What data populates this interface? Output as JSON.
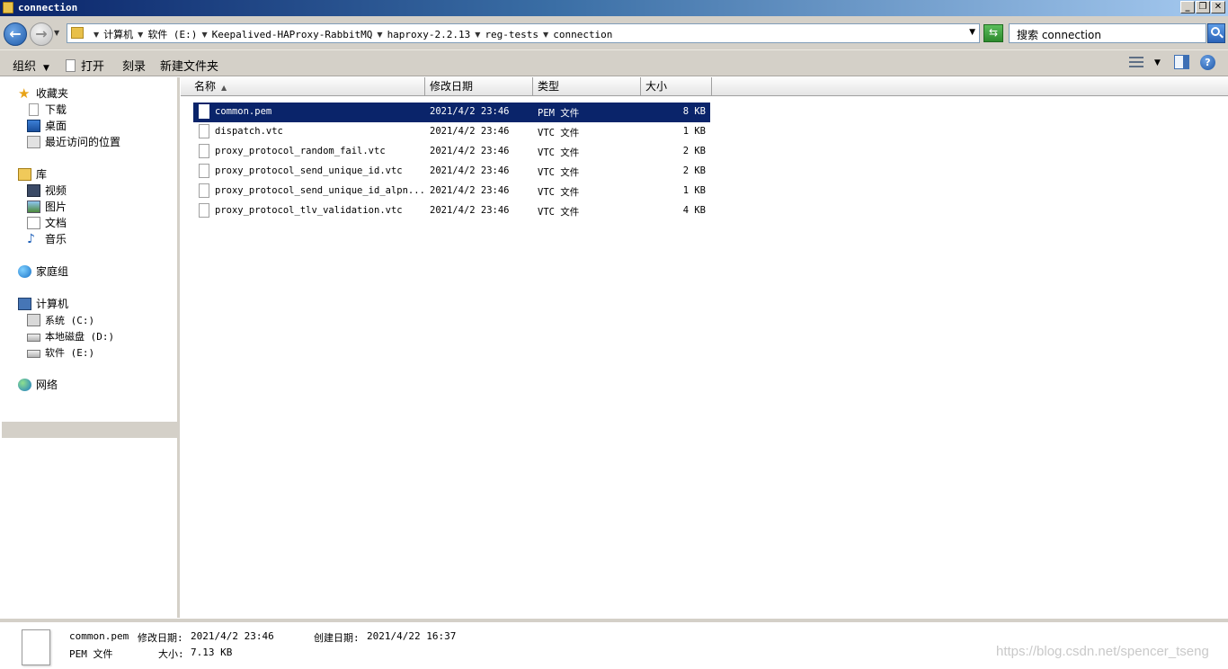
{
  "window": {
    "title": "connection"
  },
  "nav": {
    "breadcrumbs": [
      "计算机",
      "软件 (E:)",
      "Keepalived-HAProxy-RabbitMQ",
      "haproxy-2.2.13",
      "reg-tests",
      "connection"
    ]
  },
  "search": {
    "placeholder": "搜索 connection"
  },
  "toolbar": {
    "organize_label": "组织",
    "open_label": "打开",
    "burn_label": "刻录",
    "new_folder_label": "新建文件夹"
  },
  "sidebar": {
    "favorites": {
      "label": "收藏夹",
      "items": [
        "下载",
        "桌面",
        "最近访问的位置"
      ]
    },
    "libraries": {
      "label": "库",
      "items": [
        "视频",
        "图片",
        "文档",
        "音乐"
      ]
    },
    "homegroup": {
      "label": "家庭组"
    },
    "computer": {
      "label": "计算机",
      "items": [
        "系统 (C:)",
        "本地磁盘 (D:)",
        "软件 (E:)"
      ],
      "selected": "软件 (E:)"
    },
    "network": {
      "label": "网络"
    }
  },
  "columns": [
    "名称",
    "修改日期",
    "类型",
    "大小"
  ],
  "files": [
    {
      "name": "common.pem",
      "date": "2021/4/2 23:46",
      "type": "PEM 文件",
      "size": "8 KB",
      "selected": true
    },
    {
      "name": "dispatch.vtc",
      "date": "2021/4/2 23:46",
      "type": "VTC 文件",
      "size": "1 KB"
    },
    {
      "name": "proxy_protocol_random_fail.vtc",
      "date": "2021/4/2 23:46",
      "type": "VTC 文件",
      "size": "2 KB"
    },
    {
      "name": "proxy_protocol_send_unique_id.vtc",
      "date": "2021/4/2 23:46",
      "type": "VTC 文件",
      "size": "2 KB"
    },
    {
      "name": "proxy_protocol_send_unique_id_alpn...",
      "date": "2021/4/2 23:46",
      "type": "VTC 文件",
      "size": "1 KB"
    },
    {
      "name": "proxy_protocol_tlv_validation.vtc",
      "date": "2021/4/2 23:46",
      "type": "VTC 文件",
      "size": "4 KB"
    }
  ],
  "details": {
    "name": "common.pem",
    "modified_label": "修改日期:",
    "modified": "2021/4/2 23:46",
    "created_label": "创建日期:",
    "created": "2021/4/22 16:37",
    "type": "PEM 文件",
    "size_label": "大小:",
    "size": "7.13 KB"
  },
  "watermark": "https://blog.csdn.net/spencer_tseng",
  "icons": {
    "back": "back-arrow-icon",
    "forward": "forward-arrow-icon",
    "refresh": "refresh-icon",
    "search": "search-icon",
    "help": "help-icon"
  },
  "colors": {
    "selection": "#0a246a",
    "chrome": "#d4d0c8"
  }
}
